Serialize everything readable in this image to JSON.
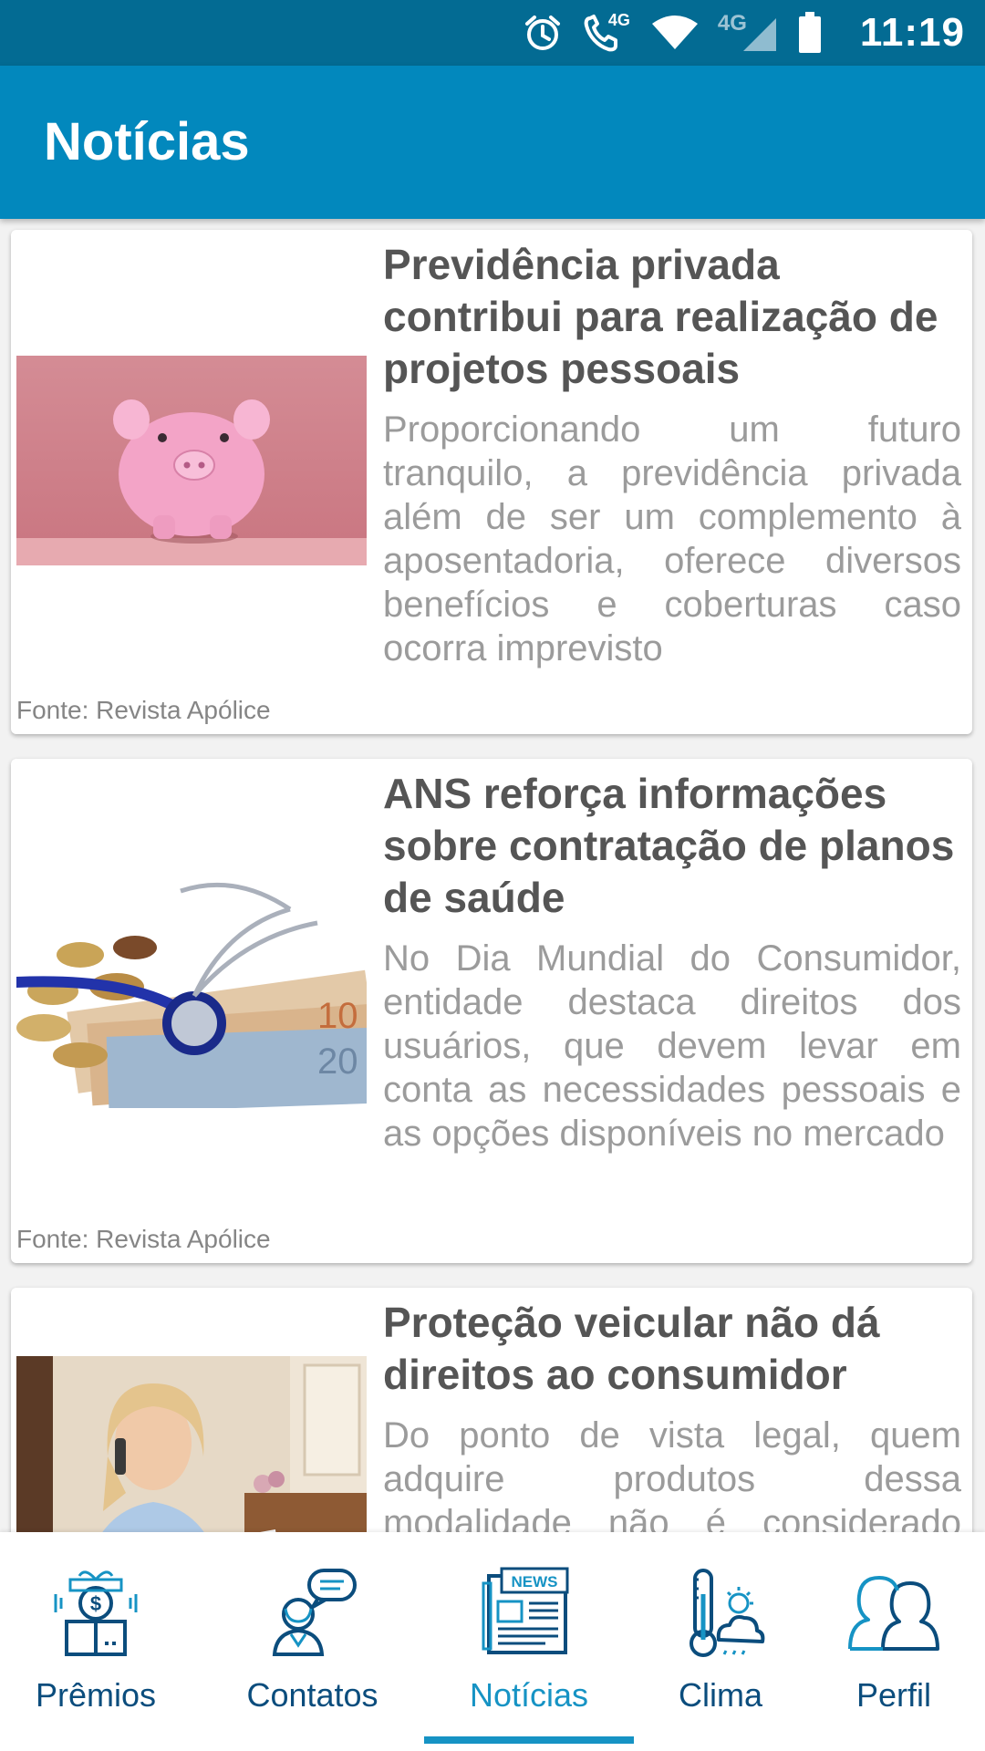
{
  "status_bar": {
    "time": "11:19",
    "call_label": "4G",
    "network_label": "4G",
    "icons": [
      "alarm-icon",
      "call-4g-icon",
      "wifi-icon",
      "signal-icon",
      "battery-icon"
    ]
  },
  "app_bar": {
    "title": "Notícias"
  },
  "colors": {
    "status_bar": "#036b93",
    "app_bar": "#0288bd",
    "accent": "#1693c4",
    "nav_text": "#0b4d7d"
  },
  "articles": [
    {
      "image": "piggy-bank",
      "title": "Previdência privada contribui para realização de projetos pessoais",
      "summary": "Proporcionando um futuro tranquilo, a previdência privada além de ser um complemento à aposentadoria, oferece diversos benefícios e coberturas caso ocorra imprevisto",
      "source": "Fonte: Revista Apólice"
    },
    {
      "image": "stethoscope-money",
      "title": "ANS reforça informações sobre contratação de planos de saúde",
      "summary": "No Dia Mundial do Consumidor, entidade destaca direitos dos usuários, que devem levar em conta as necessidades pessoais e as opções disponíveis no mercado",
      "source": "Fonte: Revista Apólice"
    },
    {
      "image": "woman-on-phone",
      "title": "Proteção veicular não dá direitos ao consumidor",
      "summary": "Do ponto de vista legal, quem adquire produtos dessa modalidade não é considerado consumidor",
      "source": ""
    }
  ],
  "bottom_nav": {
    "items": [
      {
        "label": "Prêmios",
        "icon": "gift-dollar-icon"
      },
      {
        "label": "Contatos",
        "icon": "contact-chat-icon"
      },
      {
        "label": "Notícias",
        "icon": "newspaper-icon",
        "badge": "NEWS"
      },
      {
        "label": "Clima",
        "icon": "weather-thermometer-icon"
      },
      {
        "label": "Perfil",
        "icon": "profile-users-icon"
      }
    ],
    "active": "Notícias"
  }
}
